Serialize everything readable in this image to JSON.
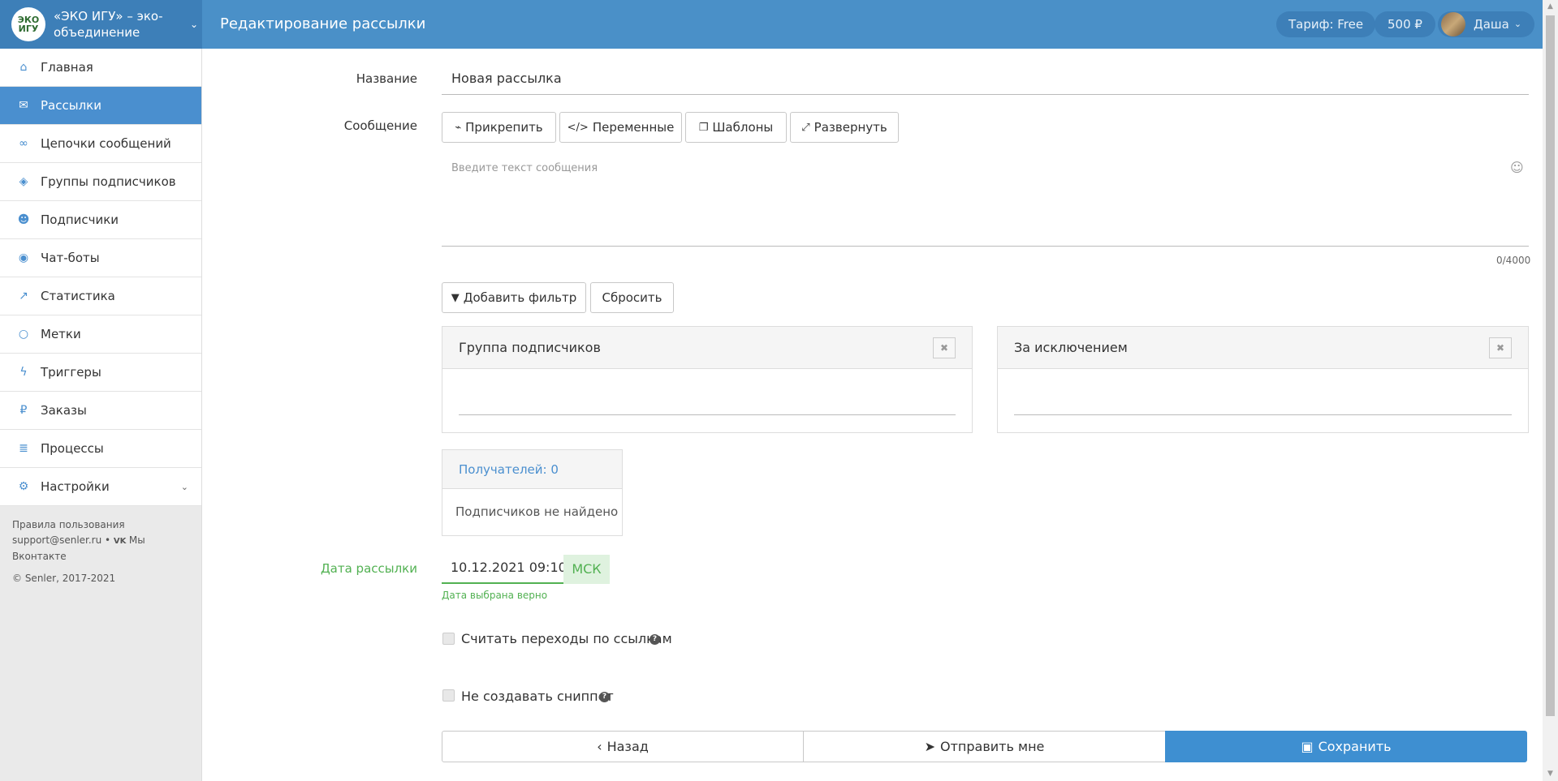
{
  "header": {
    "brand_logo": "ЭКО ИГУ",
    "brand_name": "«ЭКО ИГУ» – эко-объединение",
    "page_title": "Редактирование рассылки",
    "tariff": "Тариф: Free",
    "balance": "500 ₽",
    "user_name": "Даша"
  },
  "sidebar": {
    "items": [
      {
        "label": "Главная",
        "icon": "home-icon",
        "glyph": "⌂"
      },
      {
        "label": "Рассылки",
        "icon": "envelope-icon",
        "glyph": "✉"
      },
      {
        "label": "Цепочки сообщений",
        "icon": "link-icon",
        "glyph": "∞"
      },
      {
        "label": "Группы подписчиков",
        "icon": "tags-icon",
        "glyph": "◈"
      },
      {
        "label": "Подписчики",
        "icon": "users-icon",
        "glyph": "☻"
      },
      {
        "label": "Чат-боты",
        "icon": "android-icon",
        "glyph": "◉"
      },
      {
        "label": "Статистика",
        "icon": "line-chart-icon",
        "glyph": "↗"
      },
      {
        "label": "Метки",
        "icon": "circle-icon",
        "glyph": "○"
      },
      {
        "label": "Триггеры",
        "icon": "bolt-icon",
        "glyph": "ϟ"
      },
      {
        "label": "Заказы",
        "icon": "ruble-icon",
        "glyph": "₽"
      },
      {
        "label": "Процессы",
        "icon": "server-icon",
        "glyph": "≣"
      },
      {
        "label": "Настройки",
        "icon": "cogs-icon",
        "glyph": "⚙"
      }
    ],
    "footer_terms": "Правила пользования",
    "footer_support": "support@senler.ru • ",
    "footer_vk": "Мы Вконтакте",
    "footer_copy": "© Senler, 2017-2021"
  },
  "form": {
    "name_label": "Название",
    "name_value": "Новая рассылка",
    "message_label": "Сообщение",
    "attach": "Прикрепить",
    "variables": "Переменные",
    "templates": "Шаблоны",
    "expand": "Развернуть",
    "message_placeholder": "Введите текст сообщения",
    "counter": "0/4000",
    "add_filter": "Добавить фильтр",
    "reset": "Сбросить",
    "group_panel_title": "Группа подписчиков",
    "except_panel_title": "За исключением",
    "recipients": "Получателей: 0",
    "no_subscribers": "Подписчиков не найдено",
    "date_label": "Дата рассылки",
    "date_value": "10.12.2021 09:10",
    "timezone": "МСК",
    "date_hint": "Дата выбрана верно",
    "track_links": "Считать переходы по ссылкам",
    "no_snippet": "Не создавать сниппет",
    "back": "Назад",
    "send_me": "Отправить мне",
    "save": "Сохранить"
  },
  "colors": {
    "header": "#4a90c8",
    "accent": "#4a8fcf",
    "success": "#52b152"
  }
}
